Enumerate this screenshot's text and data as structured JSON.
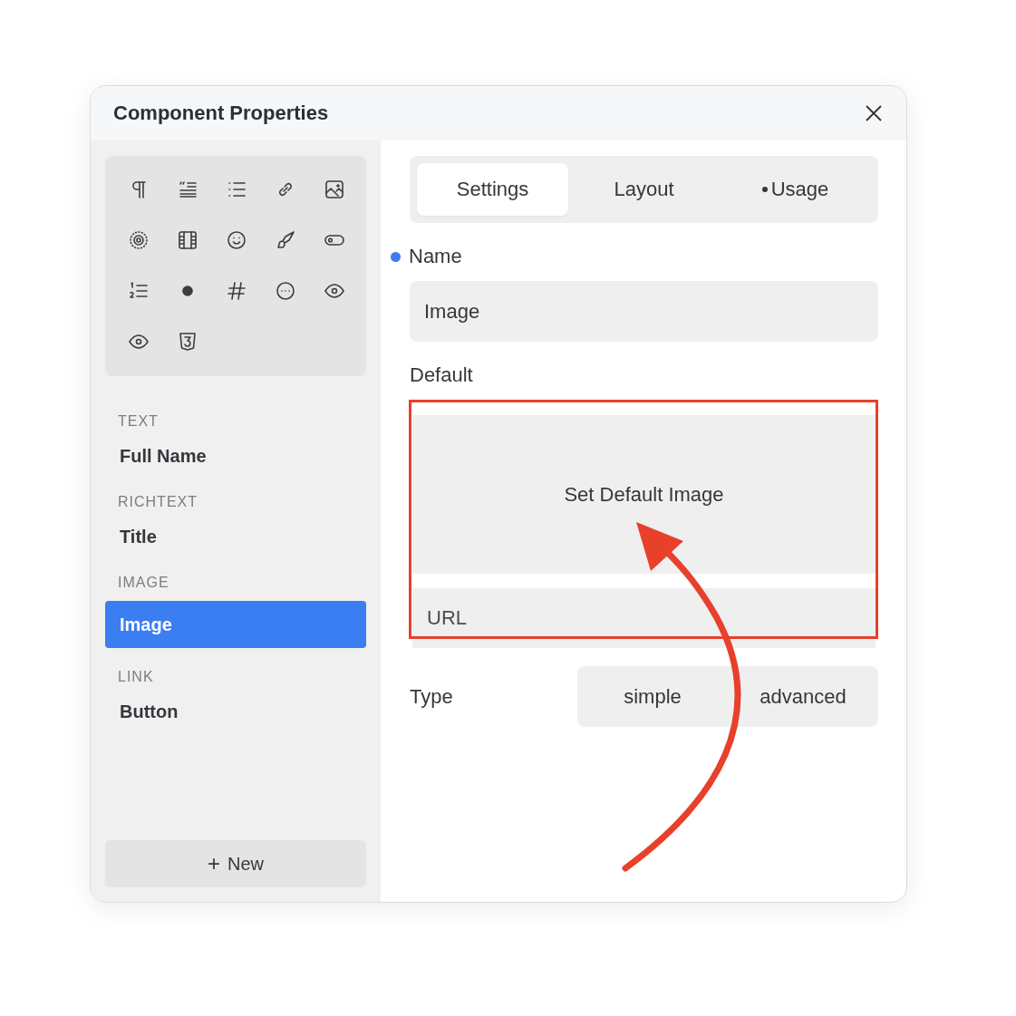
{
  "window": {
    "title": "Component Properties"
  },
  "sidebar": {
    "groups": [
      {
        "heading": "TEXT",
        "items": [
          {
            "label": "Full Name",
            "selected": false
          }
        ]
      },
      {
        "heading": "RICHTEXT",
        "items": [
          {
            "label": "Title",
            "selected": false
          }
        ]
      },
      {
        "heading": "IMAGE",
        "items": [
          {
            "label": "Image",
            "selected": true
          }
        ]
      },
      {
        "heading": "LINK",
        "items": [
          {
            "label": "Button",
            "selected": false
          }
        ]
      }
    ],
    "new_button": {
      "icon": "+",
      "label": "New"
    }
  },
  "tabs": [
    {
      "label": "Settings",
      "selected": true,
      "marked": false
    },
    {
      "label": "Layout",
      "selected": false,
      "marked": false
    },
    {
      "label": "Usage",
      "selected": false,
      "marked": true
    }
  ],
  "fields": {
    "name": {
      "label": "Name",
      "marked": true,
      "value": "Image"
    },
    "default": {
      "label": "Default",
      "button": "Set Default Image",
      "url_placeholder": "URL",
      "highlighted": true
    },
    "type": {
      "label": "Type",
      "options": [
        "simple",
        "advanced"
      ]
    }
  }
}
